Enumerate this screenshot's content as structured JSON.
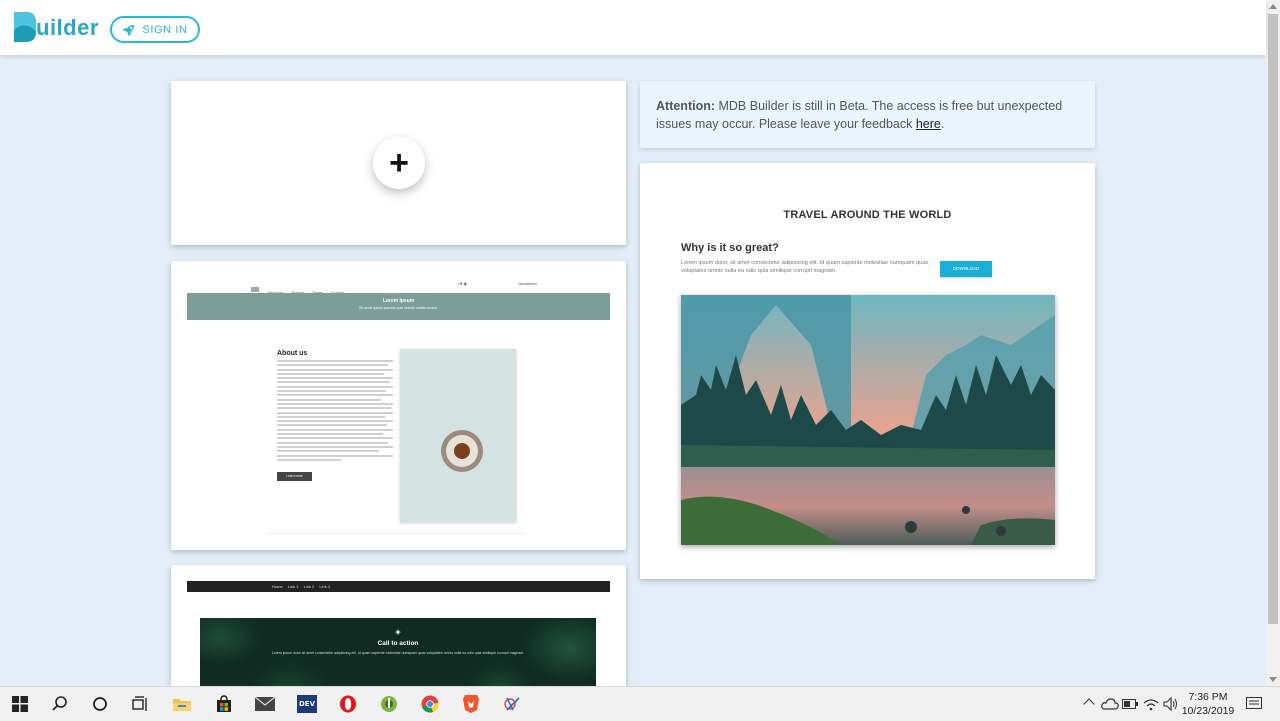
{
  "header": {
    "logo_text": "uilder",
    "signin_label": "SIGN IN",
    "brand_color": "#2bb7d5"
  },
  "add_card": {
    "plus": "+"
  },
  "alert": {
    "bold": "Attention:",
    "text": " MDB Builder is still in Beta. The access is free but unexpected issues may occur. Please leave your feedback ",
    "link": "here",
    "end": "."
  },
  "about_template": {
    "nav_items": [
      "About us",
      "Pricing",
      "Team",
      "Contact"
    ],
    "nav_right": "Newsletter",
    "banner_title": "Lorem Ipsum",
    "banner_sub": "Sit amet ipsum gravida quis blandit mattis cursus.",
    "section_title": "About us",
    "button": "Learn more"
  },
  "cta_template": {
    "nav_items": [
      "Home",
      "Link 1",
      "Link 2",
      "Link 3"
    ],
    "title": "Call to action",
    "text": "Lorem ipsum dolor sit amet consectetur adipisicing elit. Id quam sapiente molestiae numquam quas voluptates omnis nulla ea odio quia similique corrupti magnam."
  },
  "travel_template": {
    "title": "TRAVEL AROUND THE WORLD",
    "subtitle": "Why is it so great?",
    "lorem": "Lorem ipsum dolor, sit amet consectetur adipisicing elit. Id quam sapiente molestiae numquam quas, voluptates omnis nulla ea odio quia similique corrupti magnam.",
    "download": "DOWNLOAD"
  },
  "taskbar": {
    "time": "7:36 PM",
    "date": "10/23/2019"
  }
}
